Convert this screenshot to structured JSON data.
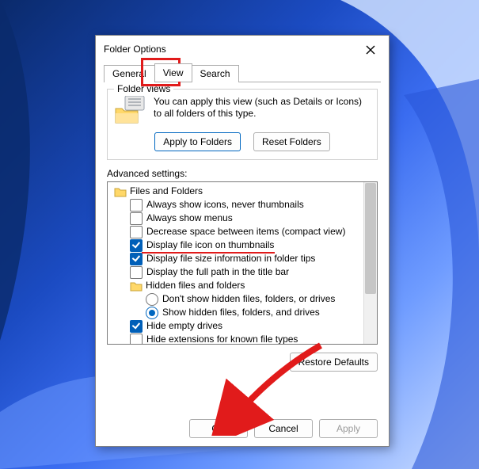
{
  "dialog": {
    "title": "Folder Options",
    "tabs": {
      "general": "General",
      "view": "View",
      "search": "Search"
    },
    "folder_views": {
      "legend": "Folder views",
      "desc": "You can apply this view (such as Details or Icons) to all folders of this type.",
      "apply": "Apply to Folders",
      "reset": "Reset Folders"
    },
    "advanced": {
      "label": "Advanced settings:",
      "root": "Files and Folders",
      "items": {
        "always_icons": "Always show icons, never thumbnails",
        "always_menus": "Always show menus",
        "compact": "Decrease space between items (compact view)",
        "file_icon_thumb": "Display file icon on thumbnails",
        "file_size_tips": "Display file size information in folder tips",
        "full_path_title": "Display the full path in the title bar",
        "hidden_group": "Hidden files and folders",
        "hidden_dont": "Don't show hidden files, folders, or drives",
        "hidden_show": "Show hidden files, folders, and drives",
        "hide_empty": "Hide empty drives",
        "hide_ext": "Hide extensions for known file types"
      },
      "restore": "Restore Defaults"
    },
    "buttons": {
      "ok": "OK",
      "cancel": "Cancel",
      "apply": "Apply"
    }
  }
}
